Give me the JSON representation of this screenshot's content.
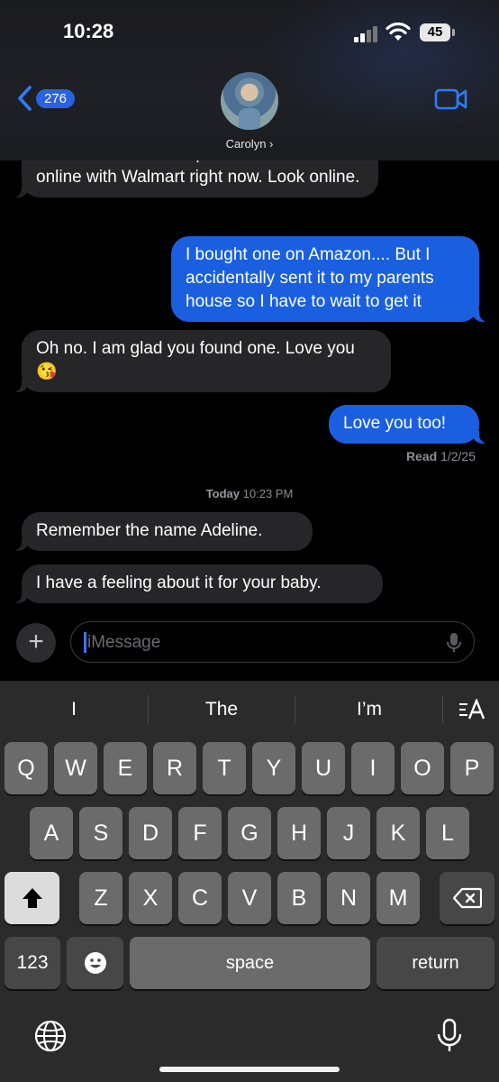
{
  "status": {
    "time": "10:28",
    "battery": "45"
  },
  "header": {
    "back_count": "276",
    "contact_name": "Carolyn ›"
  },
  "messages": [
    {
      "from": "them",
      "text": "There are numerous planners on sale online with Walmart right now. Look online."
    },
    {
      "from": "me",
      "text": "I bought one on Amazon.... But I accidentally sent it to my parents house so I have to wait to get it"
    },
    {
      "from": "them",
      "text": "Oh no.   I am glad you found one.  Love you 😘"
    },
    {
      "from": "me",
      "text": "Love you too!"
    },
    {
      "from": "them",
      "text": "Remember the name Adeline."
    },
    {
      "from": "them",
      "text": "I have a feeling about it for your baby."
    }
  ],
  "read_receipt": {
    "label": "Read",
    "date": "1/2/25"
  },
  "timestamp": {
    "day": "Today",
    "time": "10:23 PM"
  },
  "compose": {
    "placeholder": "iMessage"
  },
  "keyboard": {
    "suggestions": [
      "I",
      "The",
      "I’m"
    ],
    "row1": [
      "Q",
      "W",
      "E",
      "R",
      "T",
      "Y",
      "U",
      "I",
      "O",
      "P"
    ],
    "row2": [
      "A",
      "S",
      "D",
      "F",
      "G",
      "H",
      "J",
      "K",
      "L"
    ],
    "row3": [
      "Z",
      "X",
      "C",
      "V",
      "B",
      "N",
      "M"
    ],
    "numbers": "123",
    "space": "space",
    "return": "return"
  },
  "icons": [
    "back-chevron-icon",
    "video-camera-icon",
    "plus-icon",
    "mic-icon",
    "shift-icon",
    "delete-icon",
    "emoji-icon",
    "globe-icon",
    "dictation-mic-icon",
    "text-format-icon"
  ]
}
